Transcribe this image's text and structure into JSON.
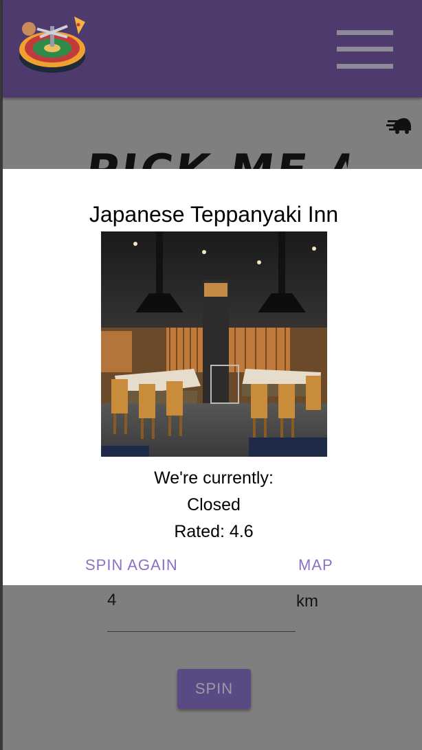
{
  "header": {
    "logo_icon": "roulette-food-logo-icon",
    "menu_icon": "hamburger-menu-icon",
    "bar_color": "#4e3a6c"
  },
  "page": {
    "speed_icon": "fast-forward-speed-icon",
    "heading": "PICK ME A",
    "distance_value": "4",
    "distance_unit": "km",
    "spin_label": "SPIN"
  },
  "dialog": {
    "title": "Japanese Teppanyaki Inn",
    "status_heading": "We're currently:",
    "status_value": "Closed",
    "rating": "Rated: 4.6",
    "spin_again_label": "SPIN AGAIN",
    "map_label": "MAP",
    "accent_color": "#8d6ec4"
  }
}
